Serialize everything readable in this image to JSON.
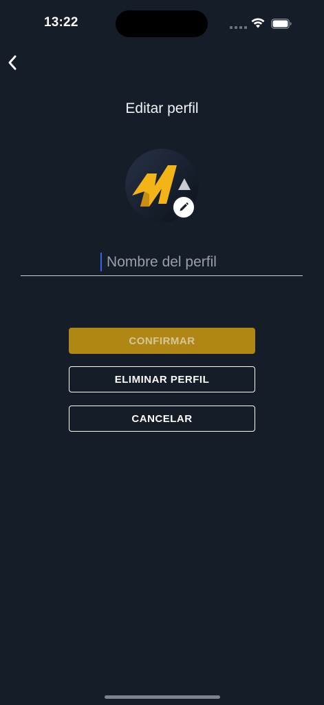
{
  "status_bar": {
    "time": "13:22"
  },
  "header": {
    "title": "Editar perfil"
  },
  "form": {
    "name_placeholder": "Nombre del perfil",
    "name_value": ""
  },
  "buttons": {
    "confirm": "CONFIRMAR",
    "delete": "ELIMINAR PERFIL",
    "cancel": "CANCELAR"
  },
  "colors": {
    "background": "#151d28",
    "accent_gold": "#b08614",
    "logo_yellow": "#f3b417",
    "caret_blue": "#3b62e8"
  },
  "icons": {
    "back": "chevron-left-icon",
    "edit": "pencil-icon",
    "wifi": "wifi-icon",
    "battery": "battery-icon",
    "signal": "signal-icon"
  }
}
